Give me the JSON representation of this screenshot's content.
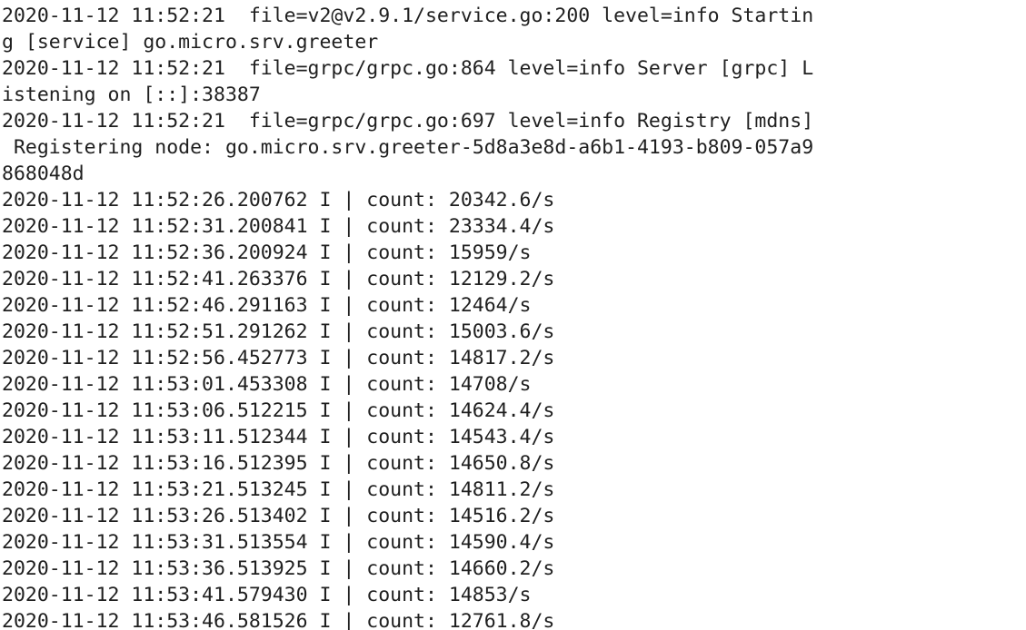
{
  "terminal": {
    "lines": [
      "2020-11-12 11:52:21  file=v2@v2.9.1/service.go:200 level=info Startin",
      "g [service] go.micro.srv.greeter",
      "2020-11-12 11:52:21  file=grpc/grpc.go:864 level=info Server [grpc] L",
      "istening on [::]:38387",
      "2020-11-12 11:52:21  file=grpc/grpc.go:697 level=info Registry [mdns]",
      " Registering node: go.micro.srv.greeter-5d8a3e8d-a6b1-4193-b809-057a9",
      "868048d",
      "2020-11-12 11:52:26.200762 I | count: 20342.6/s",
      "2020-11-12 11:52:31.200841 I | count: 23334.4/s",
      "2020-11-12 11:52:36.200924 I | count: 15959/s",
      "2020-11-12 11:52:41.263376 I | count: 12129.2/s",
      "2020-11-12 11:52:46.291163 I | count: 12464/s",
      "2020-11-12 11:52:51.291262 I | count: 15003.6/s",
      "2020-11-12 11:52:56.452773 I | count: 14817.2/s",
      "2020-11-12 11:53:01.453308 I | count: 14708/s",
      "2020-11-12 11:53:06.512215 I | count: 14624.4/s",
      "2020-11-12 11:53:11.512344 I | count: 14543.4/s",
      "2020-11-12 11:53:16.512395 I | count: 14650.8/s",
      "2020-11-12 11:53:21.513245 I | count: 14811.2/s",
      "2020-11-12 11:53:26.513402 I | count: 14516.2/s",
      "2020-11-12 11:53:31.513554 I | count: 14590.4/s",
      "2020-11-12 11:53:36.513925 I | count: 14660.2/s",
      "2020-11-12 11:53:41.579430 I | count: 14853/s",
      "2020-11-12 11:53:46.581526 I | count: 12761.8/s"
    ]
  }
}
